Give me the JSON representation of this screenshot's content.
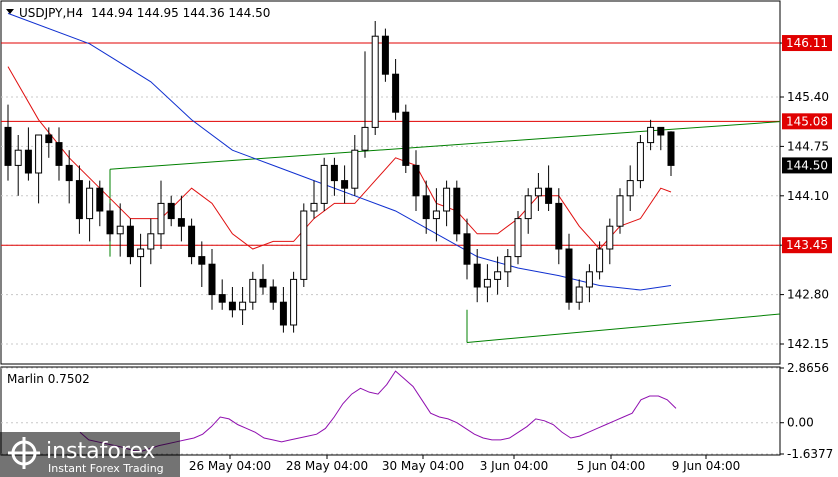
{
  "header": {
    "symbol": "USDJPY,H4",
    "ohlc": "144.94 144.95 144.36 144.50"
  },
  "colors": {
    "frame": "#000000",
    "grid": "#c8c8c8",
    "level_line": "#e00000",
    "trend_line": "#008000",
    "ma_fast": "#e01010",
    "ma_slow": "#1030d0",
    "oscillator": "#9010b0",
    "candle_bull_fill": "#ffffff",
    "candle_bear_fill": "#000000",
    "price_tag_bg": "#000000",
    "level_tag_bg": "#e00000"
  },
  "indicator": {
    "label": "Marlin 0.7502"
  },
  "watermark": {
    "brand": "instaforex",
    "tagline": "Instant Forex Trading"
  },
  "chart_data": {
    "type": "candlestick",
    "symbol": "USDJPY",
    "timeframe": "H4",
    "price_axis": {
      "ylim": [
        141.9,
        146.65
      ],
      "ticks": [
        "146.11",
        "145.40",
        "144.75",
        "144.10",
        "143.45",
        "142.80",
        "142.15"
      ]
    },
    "time_axis": {
      "labels": [
        "26 May 04:00",
        "28 May 04:00",
        "30 May 04:00",
        "3 Jun 04:00",
        "5 Jun 04:00",
        "9 Jun 04:00"
      ]
    },
    "current_price": "144.50",
    "levels": [
      {
        "label": "146.11",
        "value": 146.11
      },
      {
        "label": "145.08",
        "value": 145.08
      },
      {
        "label": "143.45",
        "value": 143.45
      }
    ],
    "trend_lines": [
      {
        "points": [
          [
            10,
            144.45
          ],
          [
            95,
            145.26
          ]
        ]
      },
      {
        "points": [
          [
            45,
            142.17
          ],
          [
            95,
            142.78
          ]
        ]
      }
    ],
    "candles": [
      [
        145.0,
        145.3,
        144.3,
        144.5
      ],
      [
        144.5,
        144.9,
        144.1,
        144.7
      ],
      [
        144.7,
        145.0,
        144.3,
        144.4
      ],
      [
        144.4,
        144.8,
        144.0,
        144.9
      ],
      [
        144.9,
        145.0,
        144.6,
        144.8
      ],
      [
        144.8,
        145.0,
        144.3,
        144.5
      ],
      [
        144.5,
        144.7,
        144.0,
        144.3
      ],
      [
        144.3,
        144.5,
        143.6,
        143.8
      ],
      [
        143.8,
        144.3,
        143.5,
        144.2
      ],
      [
        144.2,
        144.3,
        143.7,
        143.9
      ],
      [
        143.9,
        144.0,
        143.5,
        143.6
      ],
      [
        143.6,
        144.0,
        143.3,
        143.7
      ],
      [
        143.7,
        143.8,
        143.2,
        143.3
      ],
      [
        143.3,
        143.6,
        142.9,
        143.4
      ],
      [
        143.4,
        143.8,
        143.2,
        143.6
      ],
      [
        143.6,
        144.3,
        143.4,
        144.0
      ],
      [
        144.0,
        144.1,
        143.7,
        143.8
      ],
      [
        143.8,
        144.1,
        143.5,
        143.7
      ],
      [
        143.7,
        143.8,
        143.2,
        143.3
      ],
      [
        143.3,
        143.5,
        142.9,
        143.2
      ],
      [
        143.2,
        143.4,
        142.6,
        142.8
      ],
      [
        142.8,
        143.0,
        142.6,
        142.7
      ],
      [
        142.7,
        142.9,
        142.5,
        142.6
      ],
      [
        142.6,
        142.9,
        142.4,
        142.7
      ],
      [
        142.7,
        143.1,
        142.6,
        143.0
      ],
      [
        143.0,
        143.2,
        142.8,
        142.9
      ],
      [
        142.9,
        143.0,
        142.6,
        142.7
      ],
      [
        142.7,
        142.9,
        142.3,
        142.4
      ],
      [
        142.4,
        143.1,
        142.3,
        143.0
      ],
      [
        143.0,
        144.0,
        142.9,
        143.9
      ],
      [
        143.9,
        144.3,
        143.8,
        144.0
      ],
      [
        144.0,
        144.6,
        143.9,
        144.5
      ],
      [
        144.5,
        144.6,
        144.1,
        144.3
      ],
      [
        144.3,
        144.5,
        144.0,
        144.2
      ],
      [
        144.2,
        144.9,
        144.1,
        144.7
      ],
      [
        144.7,
        146.0,
        144.6,
        145.0
      ],
      [
        145.0,
        146.4,
        144.9,
        146.2
      ],
      [
        146.2,
        146.3,
        145.6,
        145.7
      ],
      [
        145.7,
        145.9,
        145.1,
        145.2
      ],
      [
        145.2,
        145.3,
        144.4,
        144.5
      ],
      [
        144.5,
        144.7,
        143.9,
        144.1
      ],
      [
        144.1,
        144.3,
        143.6,
        143.8
      ],
      [
        143.8,
        144.2,
        143.5,
        143.9
      ],
      [
        143.9,
        144.3,
        143.7,
        144.2
      ],
      [
        144.2,
        144.3,
        143.5,
        143.6
      ],
      [
        143.6,
        143.8,
        143.0,
        143.2
      ],
      [
        143.2,
        143.4,
        142.7,
        142.9
      ],
      [
        142.9,
        143.2,
        142.7,
        143.0
      ],
      [
        143.0,
        143.3,
        142.8,
        143.1
      ],
      [
        143.1,
        143.4,
        142.9,
        143.3
      ],
      [
        143.3,
        143.9,
        143.2,
        143.8
      ],
      [
        143.8,
        144.2,
        143.6,
        144.1
      ],
      [
        144.1,
        144.4,
        143.9,
        144.2
      ],
      [
        144.2,
        144.5,
        143.9,
        144.0
      ],
      [
        144.0,
        144.2,
        143.2,
        143.4
      ],
      [
        143.4,
        143.6,
        142.6,
        142.7
      ],
      [
        142.7,
        143.0,
        142.6,
        142.9
      ],
      [
        142.9,
        143.2,
        142.7,
        143.1
      ],
      [
        143.1,
        143.5,
        143.0,
        143.4
      ],
      [
        143.4,
        143.8,
        143.2,
        143.7
      ],
      [
        143.7,
        144.2,
        143.6,
        144.1
      ],
      [
        144.1,
        144.5,
        143.9,
        144.3
      ],
      [
        144.3,
        144.9,
        144.2,
        144.8
      ],
      [
        144.8,
        145.1,
        144.7,
        145.0
      ],
      [
        145.0,
        145.0,
        144.7,
        144.9
      ],
      [
        144.94,
        144.95,
        144.36,
        144.5
      ]
    ],
    "moving_averages": [
      {
        "role": "fast",
        "values": [
          [
            0,
            145.8
          ],
          [
            3,
            145.1
          ],
          [
            6,
            144.6
          ],
          [
            9,
            144.2
          ],
          [
            12,
            143.8
          ],
          [
            15,
            143.8
          ],
          [
            18,
            144.2
          ],
          [
            20,
            144.0
          ],
          [
            22,
            143.6
          ],
          [
            24,
            143.4
          ],
          [
            26,
            143.5
          ],
          [
            28,
            143.5
          ],
          [
            30,
            143.8
          ],
          [
            32,
            144.0
          ],
          [
            34,
            144.0
          ],
          [
            36,
            144.3
          ],
          [
            38,
            144.6
          ],
          [
            40,
            144.5
          ],
          [
            42,
            144.0
          ],
          [
            44,
            143.9
          ],
          [
            46,
            143.6
          ],
          [
            48,
            143.6
          ],
          [
            50,
            143.8
          ],
          [
            52,
            144.1
          ],
          [
            54,
            144.1
          ],
          [
            56,
            143.7
          ],
          [
            58,
            143.4
          ],
          [
            60,
            143.7
          ],
          [
            62,
            143.8
          ],
          [
            64,
            144.2
          ],
          [
            65,
            144.15
          ]
        ]
      },
      {
        "role": "slow",
        "values": [
          [
            0,
            146.5
          ],
          [
            8,
            146.1
          ],
          [
            14,
            145.6
          ],
          [
            18,
            145.1
          ],
          [
            22,
            144.7
          ],
          [
            26,
            144.5
          ],
          [
            30,
            144.3
          ],
          [
            34,
            144.1
          ],
          [
            38,
            143.9
          ],
          [
            42,
            143.6
          ],
          [
            46,
            143.3
          ],
          [
            50,
            143.15
          ],
          [
            54,
            143.05
          ],
          [
            58,
            142.92
          ],
          [
            62,
            142.86
          ],
          [
            65,
            142.92
          ]
        ]
      }
    ],
    "oscillator": {
      "name": "Marlin",
      "value": 0.7502,
      "ylim": [
        -1.6377,
        2.8656
      ],
      "ticks": [
        "2.8656",
        "0.00",
        "-1.6377"
      ],
      "values": [
        -0.5,
        -0.9,
        -1.0,
        -1.1,
        -1.2,
        -1.3,
        -1.45,
        -1.5,
        -1.35,
        -1.2,
        -1.1,
        -1.0,
        -0.9,
        -0.8,
        -0.6,
        -0.2,
        0.3,
        0.2,
        -0.1,
        -0.3,
        -0.5,
        -0.8,
        -0.9,
        -1.0,
        -0.9,
        -0.8,
        -0.7,
        -0.6,
        -0.3,
        0.3,
        1.0,
        1.5,
        1.8,
        1.6,
        1.5,
        2.0,
        2.7,
        2.3,
        1.9,
        1.2,
        0.5,
        0.3,
        0.2,
        0.0,
        -0.3,
        -0.6,
        -0.8,
        -0.9,
        -0.9,
        -0.8,
        -0.5,
        -0.2,
        0.2,
        0.1,
        -0.1,
        -0.5,
        -0.8,
        -0.7,
        -0.5,
        -0.3,
        -0.1,
        0.1,
        0.3,
        0.5,
        1.2,
        1.4,
        1.4,
        1.2,
        0.75
      ]
    }
  }
}
